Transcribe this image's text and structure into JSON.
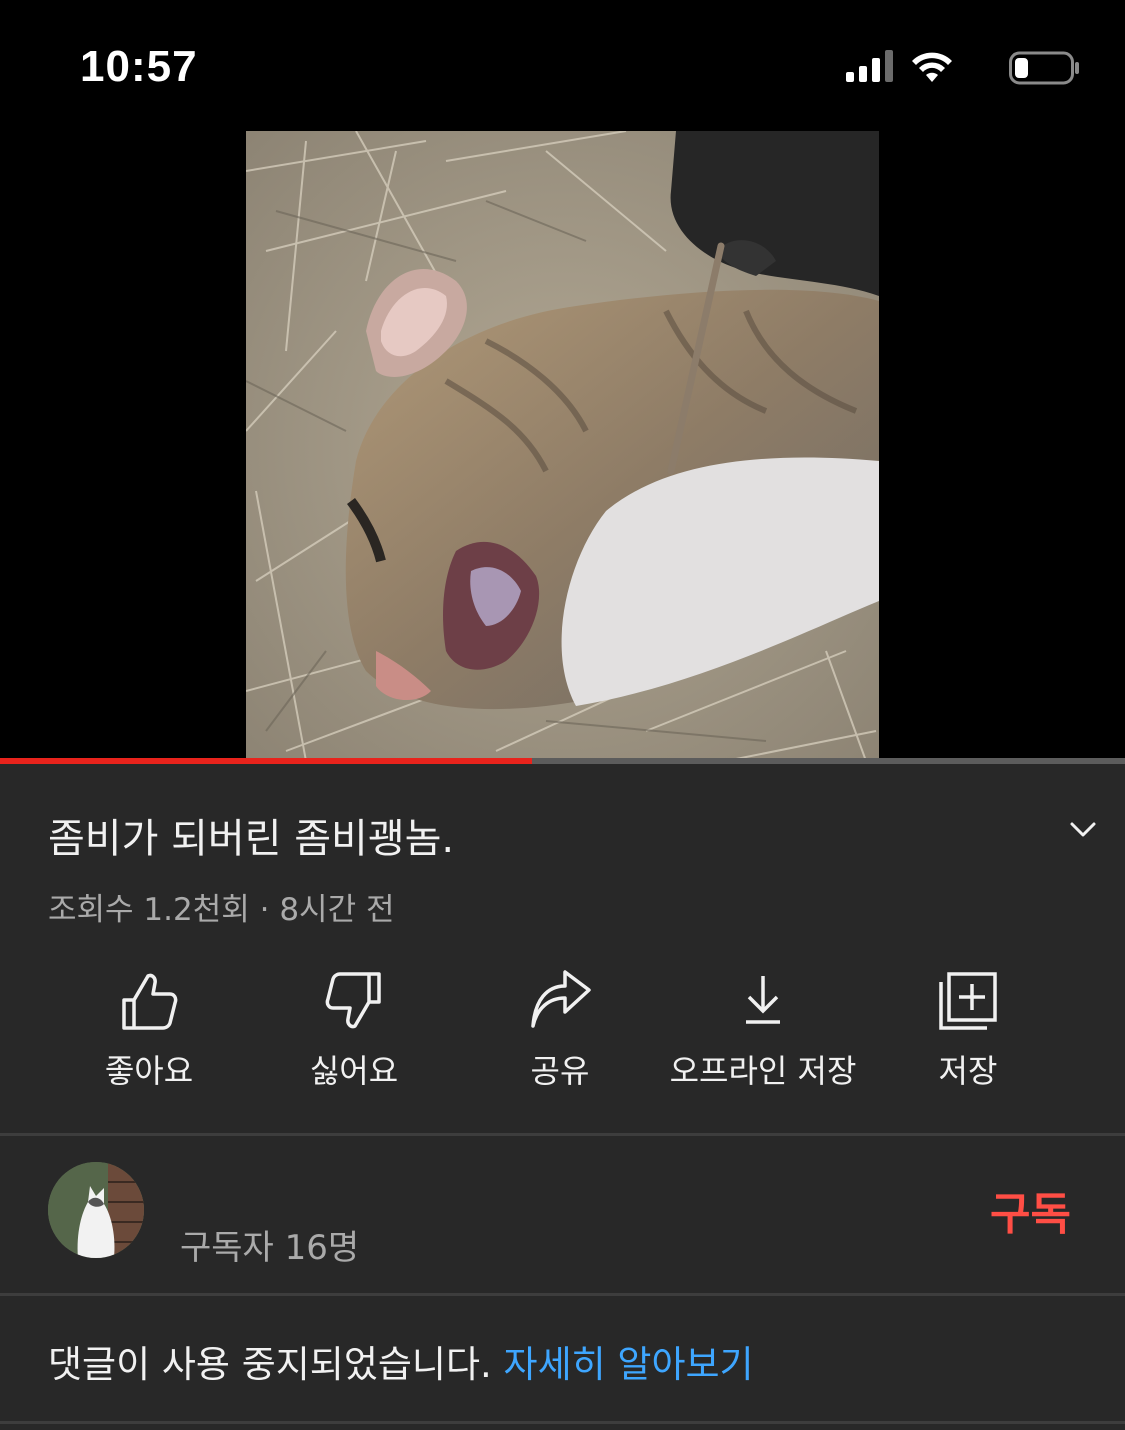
{
  "status_bar": {
    "time": "10:57"
  },
  "video": {
    "progress": 0.473
  },
  "title": "좀비가 되버린 좀비괭놈.",
  "meta": {
    "views": "조회수 1.2천회",
    "separator": " · ",
    "age": "8시간 전"
  },
  "actions": [
    {
      "label": "좋아요",
      "icon": "thumbs-up-icon"
    },
    {
      "label": "싫어요",
      "icon": "thumbs-down-icon"
    },
    {
      "label": "공유",
      "icon": "share-icon"
    },
    {
      "label": "오프라인 저장",
      "icon": "download-icon"
    },
    {
      "label": "저장",
      "icon": "add-to-playlist-icon"
    }
  ],
  "channel": {
    "subscribers": "구독자 16명",
    "subscribe_label": "구독"
  },
  "comments": {
    "message": "댓글이 사용 중지되었습니다. ",
    "learn_more": "자세히 알아보기"
  },
  "colors": {
    "accent_red": "#ff4e45",
    "progress_red": "#e8231c",
    "link_blue": "#3ea6ff",
    "background": "#282828"
  }
}
